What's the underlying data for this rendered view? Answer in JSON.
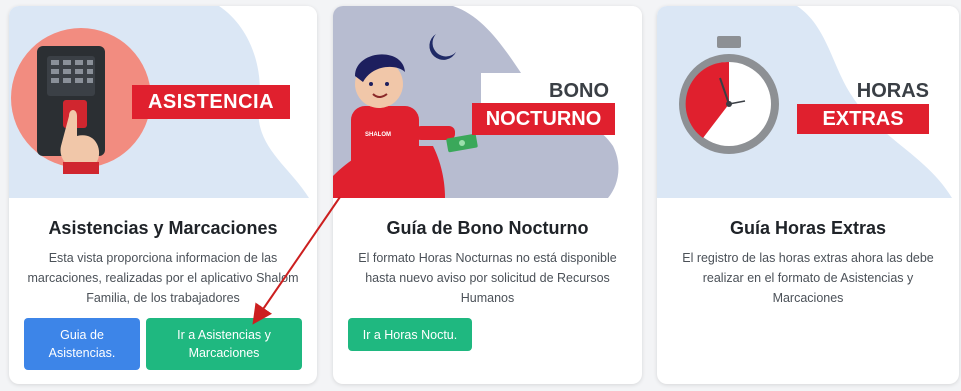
{
  "cards": [
    {
      "banner": {
        "line1": "ASISTENCIA"
      },
      "title": "Asistencias y Marcaciones",
      "description": "Esta vista proporciona informacion de las marcaciones, realizadas por el aplicativo Shalom Familia, de los trabajadores",
      "buttons": [
        {
          "label": "Guia de Asistencias."
        },
        {
          "label": "Ir a Asistencias y Marcaciones"
        }
      ]
    },
    {
      "banner": {
        "line1": "BONO",
        "line2": "NOCTURNO"
      },
      "shirt_text": "SHALOM",
      "title": "Guía de Bono Nocturno",
      "description": "El formato Horas Nocturnas no está disponible hasta nuevo aviso por solicitud de Recursos Humanos",
      "buttons": [
        {
          "label": "Ir a Horas Noctu."
        }
      ]
    },
    {
      "banner": {
        "line1": "HORAS",
        "line2": "EXTRAS"
      },
      "title": "Guía Horas Extras",
      "description": "El registro de las horas extras ahora las debe realizar en el formato de Asistencias y Marcaciones",
      "buttons": []
    }
  ],
  "colors": {
    "banner_red": "#e0202e",
    "blue_button": "#3d85e8",
    "green_button": "#1fb880",
    "annotation_arrow": "#cc1f1f"
  },
  "icons": [
    "fingerprint-scanner-icon",
    "hand-icon",
    "moon-icon",
    "banknote-icon",
    "stopwatch-icon"
  ]
}
